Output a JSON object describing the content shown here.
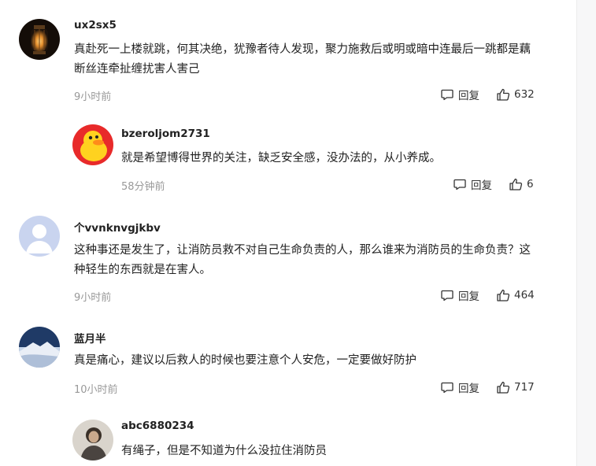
{
  "comments": [
    {
      "username": "ux2sx5",
      "text": "真赴死一上楼就跳，何其决绝，犹豫者待人发现，聚力施救后或明或暗中连最后一跳都是藕断丝连牵扯缠扰害人害己",
      "time": "9小时前",
      "reply_label": "回复",
      "likes": "632",
      "avatar_icon": "lantern-avatar"
    },
    {
      "username": "bzeroljom2731",
      "text": "就是希望博得世界的关注，缺乏安全感，没办法的，从小养成。",
      "time": "58分钟前",
      "reply_label": "回复",
      "likes": "6",
      "avatar_icon": "duck-avatar"
    },
    {
      "username": "个vvnknvgjkbv",
      "text": "这种事还是发生了，让消防员救不对自己生命负责的人，那么谁来为消防员的生命负责？这种轻生的东西就是在害人。",
      "time": "9小时前",
      "reply_label": "回复",
      "likes": "464",
      "avatar_icon": "default-user-avatar"
    },
    {
      "username": "蓝月半",
      "text": "真是痛心，建议以后救人的时候也要注意个人安危，一定要做好防护",
      "time": "10小时前",
      "reply_label": "回复",
      "likes": "717",
      "avatar_icon": "snow-mountain-avatar"
    },
    {
      "username": "abc6880234",
      "text": "有绳子，但是不知道为什么没拉住消防员",
      "avatar_icon": "person-photo-avatar"
    }
  ]
}
